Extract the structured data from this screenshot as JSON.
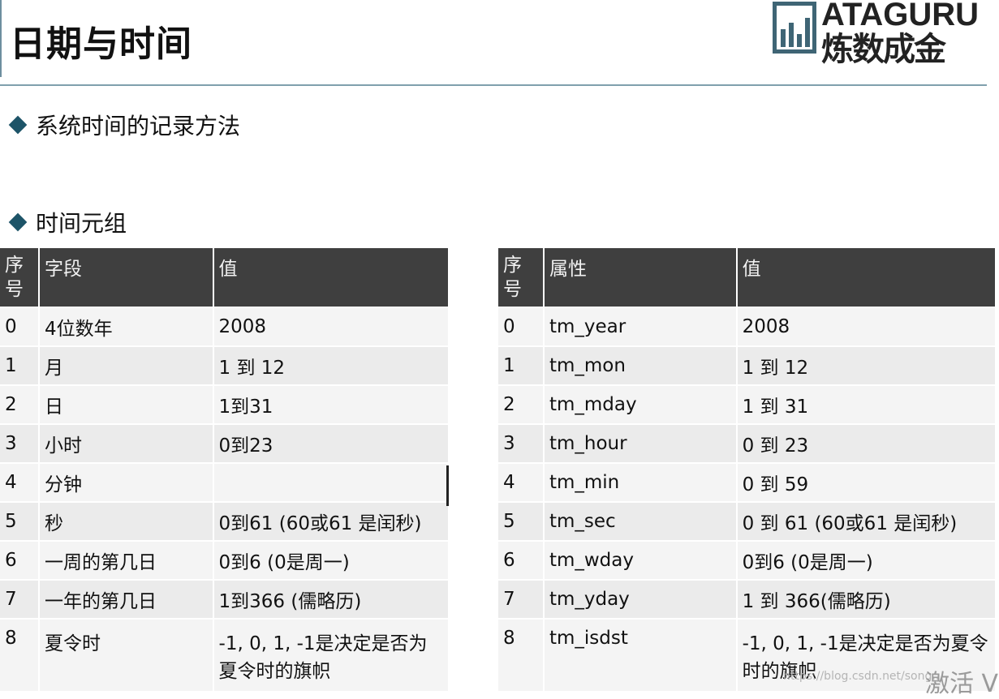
{
  "header": {
    "title": "日期与时间",
    "logo_en": "ATAGURU",
    "logo_cn": "炼数成金"
  },
  "bullets": [
    "系统时间的记录方法",
    "时间元组"
  ],
  "left_table": {
    "headers": [
      "序号",
      "字段",
      "值"
    ],
    "rows": [
      [
        "0",
        "4位数年",
        "2008"
      ],
      [
        "1",
        "月",
        "1 到 12"
      ],
      [
        "2",
        "日",
        "1到31"
      ],
      [
        "3",
        "小时",
        "0到23"
      ],
      [
        "4",
        "分钟",
        ""
      ],
      [
        "5",
        "秒",
        "0到61 (60或61 是闰秒)"
      ],
      [
        "6",
        "一周的第几日",
        "0到6 (0是周一)"
      ],
      [
        "7",
        "一年的第几日",
        "1到366 (儒略历)"
      ],
      [
        "8",
        "夏令时",
        "-1, 0, 1, -1是决定是否为夏令时的旗帜"
      ]
    ]
  },
  "right_table": {
    "headers": [
      "序号",
      "属性",
      "值"
    ],
    "rows": [
      [
        "0",
        "tm_year",
        "2008"
      ],
      [
        "1",
        "tm_mon",
        "1 到 12"
      ],
      [
        "2",
        "tm_mday",
        "1 到 31"
      ],
      [
        "3",
        "tm_hour",
        "0 到 23"
      ],
      [
        "4",
        "tm_min",
        "0 到 59"
      ],
      [
        "5",
        "tm_sec",
        "0 到 61 (60或61 是闰秒)"
      ],
      [
        "6",
        "tm_wday",
        "0到6 (0是周一)"
      ],
      [
        "7",
        "tm_yday",
        "1 到 366(儒略历)"
      ],
      [
        "8",
        "tm_isdst",
        "-1, 0, 1, -1是决定是否为夏令时的旗帜"
      ]
    ]
  },
  "watermark": {
    "text": "激活 V",
    "url": "https://blog.csdn.net/song..."
  },
  "colors": {
    "header_bg": "#3f3f3f",
    "bullet": "#1d5468",
    "rule": "#7fa0ad"
  }
}
